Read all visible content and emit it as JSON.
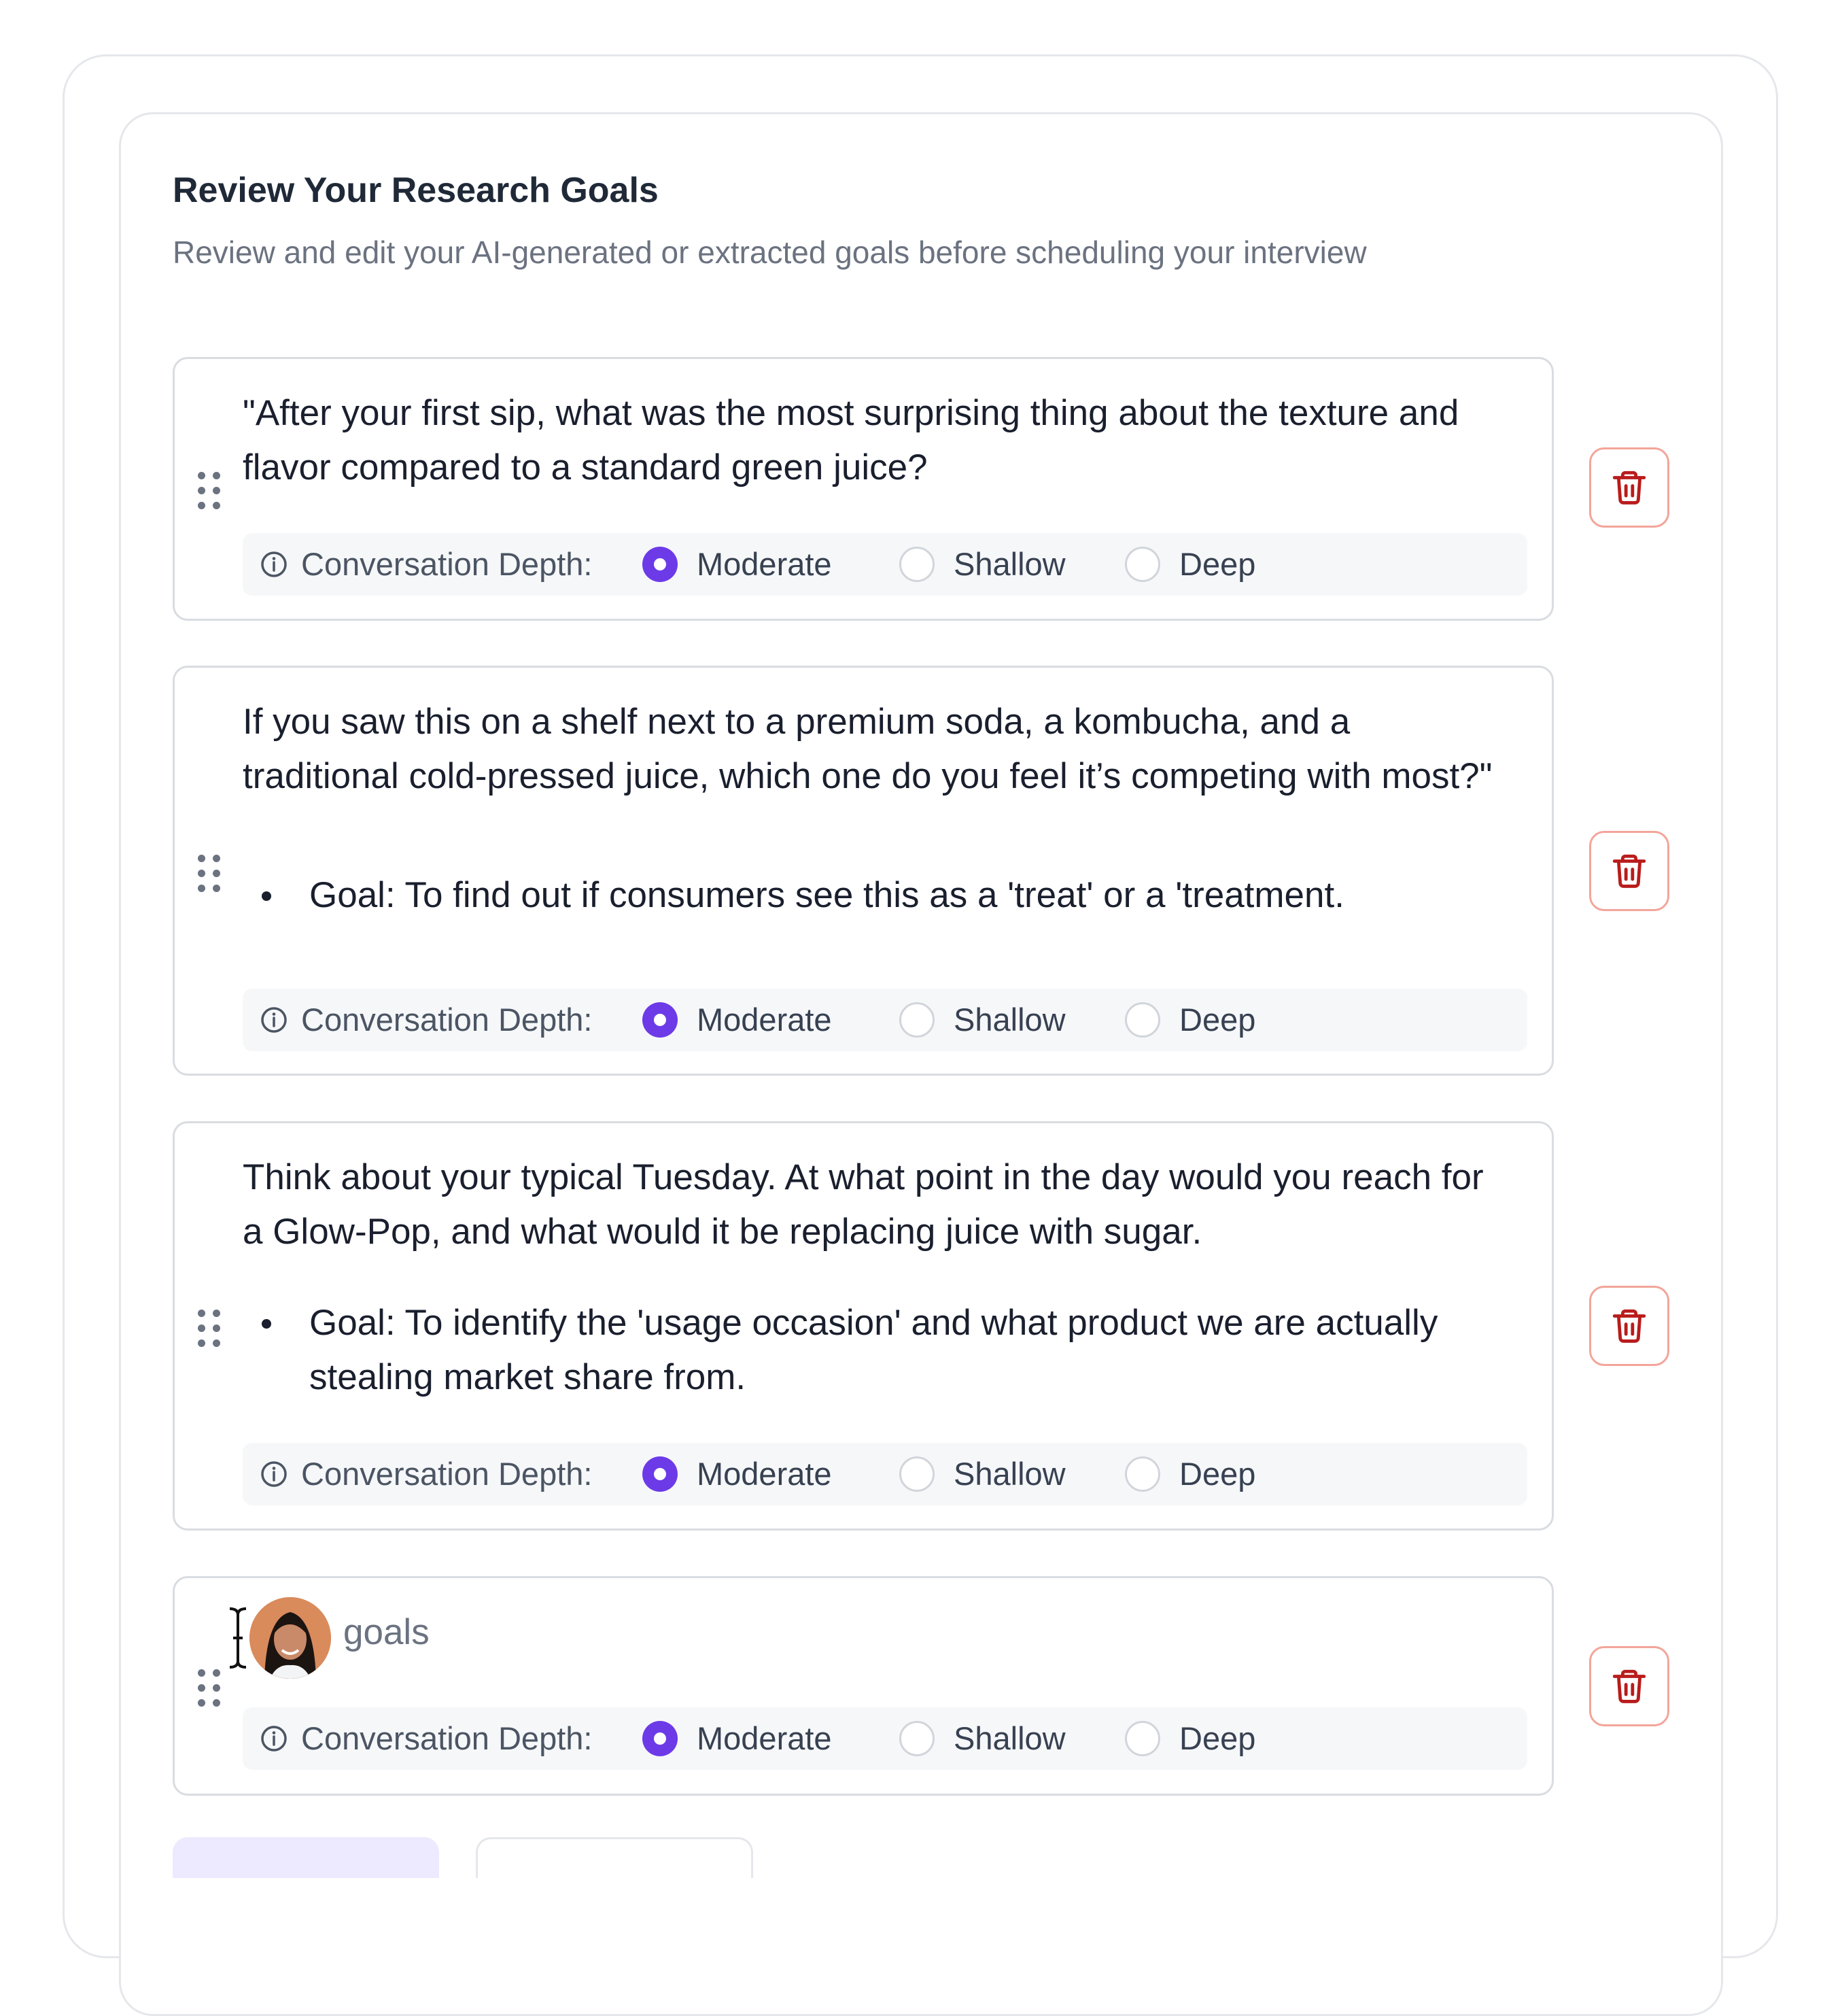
{
  "header": {
    "title": "Review Your Research Goals",
    "subtitle": "Review and edit your AI-generated or extracted goals before scheduling your interview"
  },
  "depth": {
    "label": "Conversation Depth:",
    "options": [
      "Moderate",
      "Shallow",
      "Deep"
    ]
  },
  "goals": [
    {
      "text": "\"After your first sip, what was the most surprising thing about the texture and flavor compared to a standard green juice?",
      "bullet": "",
      "selected_depth": "Moderate"
    },
    {
      "text": "If you saw this on a shelf next to a premium soda, a kombucha, and a traditional cold-pressed juice, which one do you feel it’s competing with most?\"",
      "bullet": "Goal: To find out if consumers see this as a 'treat' or a 'treatment.",
      "selected_depth": "Moderate"
    },
    {
      "text": "Think about your typical Tuesday. At what point in the day would you reach for a Glow-Pop, and what would it be replacing juice with sugar.",
      "bullet": "Goal: To identify the 'usage occasion' and what product we are actually stealing market share from.",
      "selected_depth": "Moderate"
    },
    {
      "text": "goals",
      "bullet": "",
      "selected_depth": "Moderate"
    }
  ],
  "colors": {
    "accent": "#6d3ae8",
    "danger": "#b91c1c",
    "danger_border": "#f3a59a"
  },
  "icons": {
    "drag": "drag-handle-icon",
    "info": "info-icon",
    "delete": "trash-icon"
  }
}
